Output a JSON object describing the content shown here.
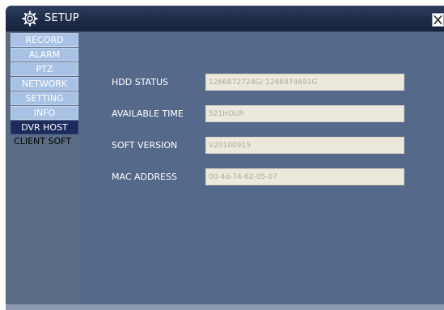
{
  "window": {
    "title": "SETUP",
    "title_icon": "gear-icon",
    "close_icon": "close-icon"
  },
  "sidebar": {
    "items": [
      {
        "label": "RECORD",
        "state": "normal"
      },
      {
        "label": "ALARM",
        "state": "normal"
      },
      {
        "label": "PTZ",
        "state": "normal"
      },
      {
        "label": "NETWORK",
        "state": "normal"
      },
      {
        "label": "SETTING",
        "state": "normal"
      },
      {
        "label": "INFO",
        "state": "normal"
      },
      {
        "label": "DVR HOST",
        "state": "active"
      },
      {
        "label": "CLIENT SOFT",
        "state": "inactive"
      }
    ]
  },
  "info": {
    "hdd_status": {
      "label": "HDD STATUS",
      "value": "1266872724G/ 1266874691G"
    },
    "available_time": {
      "label": "AVAILABLE TIME",
      "value": "521HOUR"
    },
    "soft_version": {
      "label": "SOFT VERSION",
      "value": "V20100915"
    },
    "mac_address": {
      "label": "MAC ADDRESS",
      "value": "00-4d-74-62-05-07"
    }
  },
  "colors": {
    "titlebar": "#1e2c48",
    "sidebar": "#5a6b85",
    "main_panel": "#55698a",
    "nav_button": "#a8c2e6",
    "nav_active": "#1c2a5c",
    "field_bg": "#ede8dc"
  }
}
